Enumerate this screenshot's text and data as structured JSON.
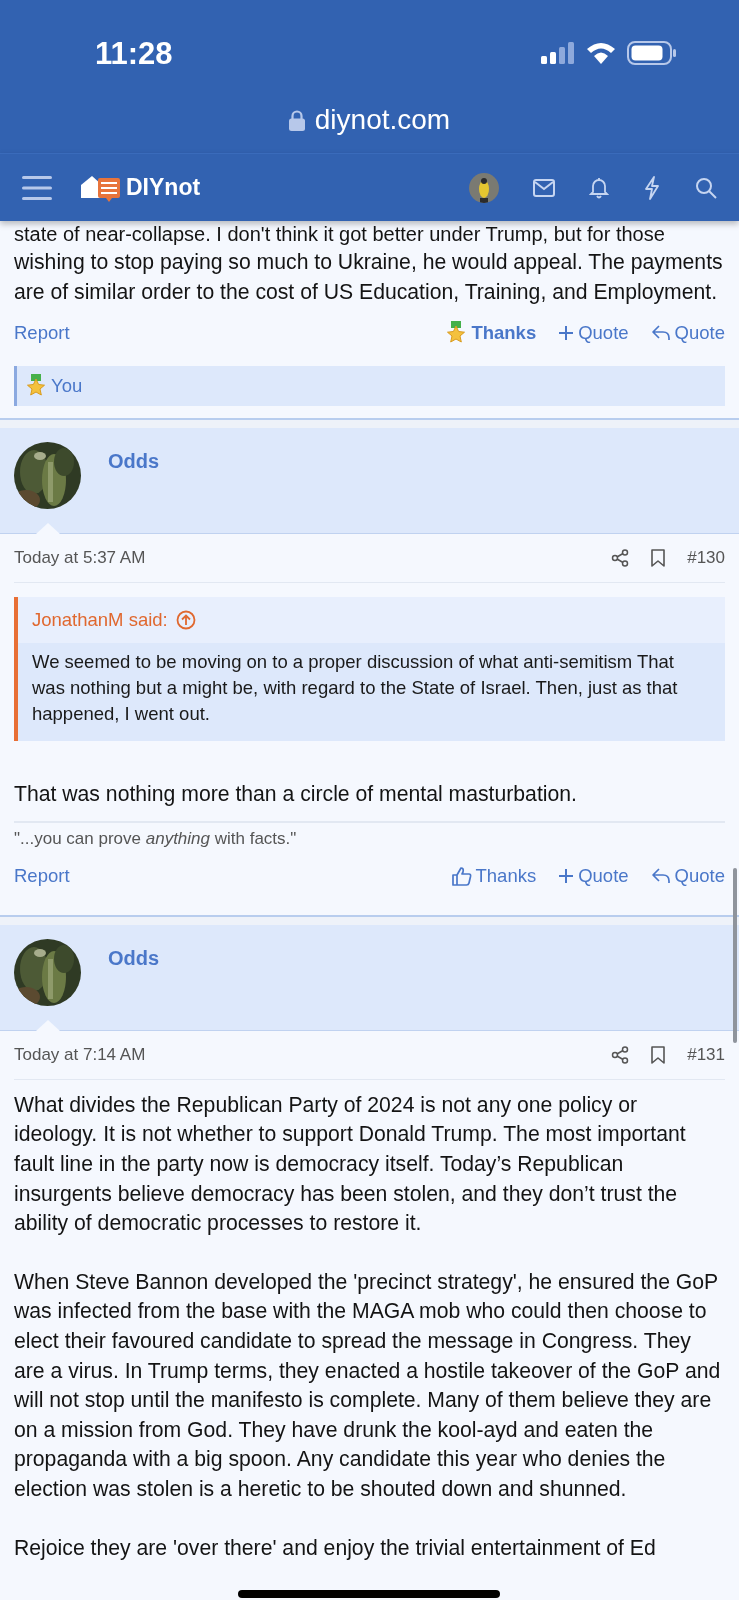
{
  "status_bar": {
    "time": "11:28"
  },
  "address_bar": {
    "url": "diynot.com"
  },
  "nav": {
    "logo": "DIYnot"
  },
  "posts": [
    {
      "kind": "continued",
      "cut_line": "state of near-collapse. I don't think it got better under Trump, but for those",
      "paragraphs": [
        "wishing to stop paying so much to Ukraine, he would appeal. The payments are of similar order to the cost of US Education, Training, and Employment."
      ],
      "actions": {
        "report": "Report",
        "thanks": "Thanks",
        "thanked": true,
        "multiquote": "Quote",
        "reply": "Quote"
      },
      "reactions": "You"
    },
    {
      "kind": "full",
      "author": "Odds",
      "date": "Today at 5:37 AM",
      "number": "#130",
      "quote": {
        "author": "JonathanM said:",
        "text": "We seemed to be moving on to a proper discussion of what anti-semitism That was nothing but a might be, with regard to the State of Israel. Then, just as that happened, I went out."
      },
      "paragraphs": [
        "That was nothing more than a circle of mental masturbation."
      ],
      "signature": "\"...you can prove *anything* with facts.\"",
      "actions": {
        "report": "Report",
        "thanks": "Thanks",
        "thanked": false,
        "multiquote": "Quote",
        "reply": "Quote"
      }
    },
    {
      "kind": "full",
      "author": "Odds",
      "date": "Today at 7:14 AM",
      "number": "#131",
      "paragraphs": [
        "What divides the Republican Party of 2024 is not any one policy or ideology. It is not whether to support Donald Trump. The most important fault line in the party now is democracy itself. Today’s Republican insurgents believe democracy has been stolen, and they don’t trust the ability of democratic processes to restore it.",
        "When Steve Bannon developed the 'precinct strategy', he ensured the GoP was infected from the base with the MAGA mob who could then choose to elect their favoured candidate to spread the message in Congress. They are a virus. In Trump terms, they enacted a hostile takeover of the GoP and will not stop until the manifesto is complete. Many of them believe they are on a mission from God. They have drunk the kool-ayd and eaten the propaganda with a big spoon. Any candidate this year who denies the election was stolen is a heretic to be shouted down and shunned.",
        "Rejoice they are 'over there' and enjoy the trivial entertainment of Ed"
      ]
    }
  ]
}
